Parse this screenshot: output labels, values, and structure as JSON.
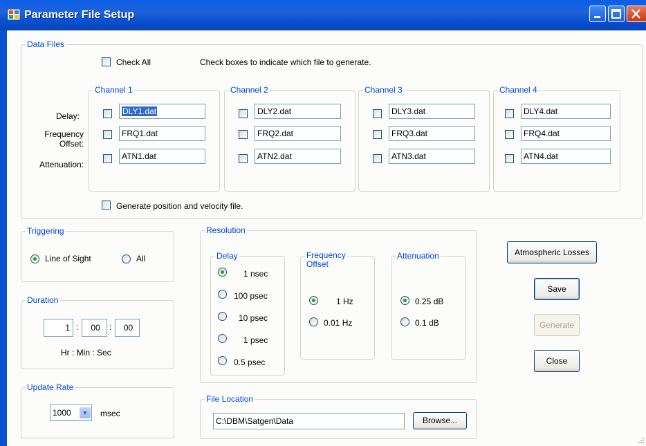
{
  "window": {
    "title": "Parameter File Setup"
  },
  "data_files": {
    "label": "Data Files",
    "check_all": {
      "label": "Check All",
      "checked": false
    },
    "instruction": "Check boxes to indicate which file to generate.",
    "row_labels": {
      "delay": "Delay:",
      "freq_line1": "Frequency",
      "freq_line2": "Offset:",
      "attenuation": "Attenuation:"
    },
    "channels": [
      {
        "label": "Channel 1",
        "delay": "DLY1.dat",
        "freq": "FRQ1.dat",
        "atten": "ATN1.dat"
      },
      {
        "label": "Channel 2",
        "delay": "DLY2.dat",
        "freq": "FRQ2.dat",
        "atten": "ATN2.dat"
      },
      {
        "label": "Channel 3",
        "delay": "DLY3.dat",
        "freq": "FRQ3.dat",
        "atten": "ATN3.dat"
      },
      {
        "label": "Channel 4",
        "delay": "DLY4.dat",
        "freq": "FRQ4.dat",
        "atten": "ATN4.dat"
      }
    ],
    "position_file": {
      "label": "Generate position and velocity file.",
      "checked": false
    }
  },
  "triggering": {
    "label": "Triggering",
    "options": [
      {
        "label": "Line of Sight",
        "selected": true
      },
      {
        "label": "All",
        "selected": false
      }
    ]
  },
  "duration": {
    "label": "Duration",
    "hr": "1",
    "min": "00",
    "sec": "00",
    "sep": ":",
    "units": "Hr : Min : Sec"
  },
  "update_rate": {
    "label": "Update Rate",
    "value": "1000",
    "units": "msec"
  },
  "resolution": {
    "label": "Resolution",
    "delay": {
      "label": "Delay",
      "options": [
        {
          "label": "1 nsec",
          "selected": true
        },
        {
          "label": "100 psec",
          "selected": false
        },
        {
          "label": "10 psec",
          "selected": false
        },
        {
          "label": "1 psec",
          "selected": false
        },
        {
          "label": "0.5 psec",
          "selected": false
        }
      ]
    },
    "frequency": {
      "label_line1": "Frequency",
      "label_line2": "Offset",
      "options": [
        {
          "label": "1 Hz",
          "selected": true
        },
        {
          "label": "0.01 Hz",
          "selected": false
        }
      ]
    },
    "attenuation": {
      "label": "Attenuation",
      "options": [
        {
          "label": "0.25 dB",
          "selected": true
        },
        {
          "label": "0.1 dB",
          "selected": false
        }
      ]
    }
  },
  "file_location": {
    "label": "File Location",
    "path": "C:\\DBM\\Satgen\\Data",
    "browse_label": "Browse..."
  },
  "buttons": {
    "atmospheric": "Atmospheric Losses",
    "save": "Save",
    "generate": "Generate",
    "close": "Close"
  },
  "colors": {
    "title_blue": "#0a5ee6",
    "group_label": "#0046d5",
    "radio_dot": "#21a121"
  }
}
